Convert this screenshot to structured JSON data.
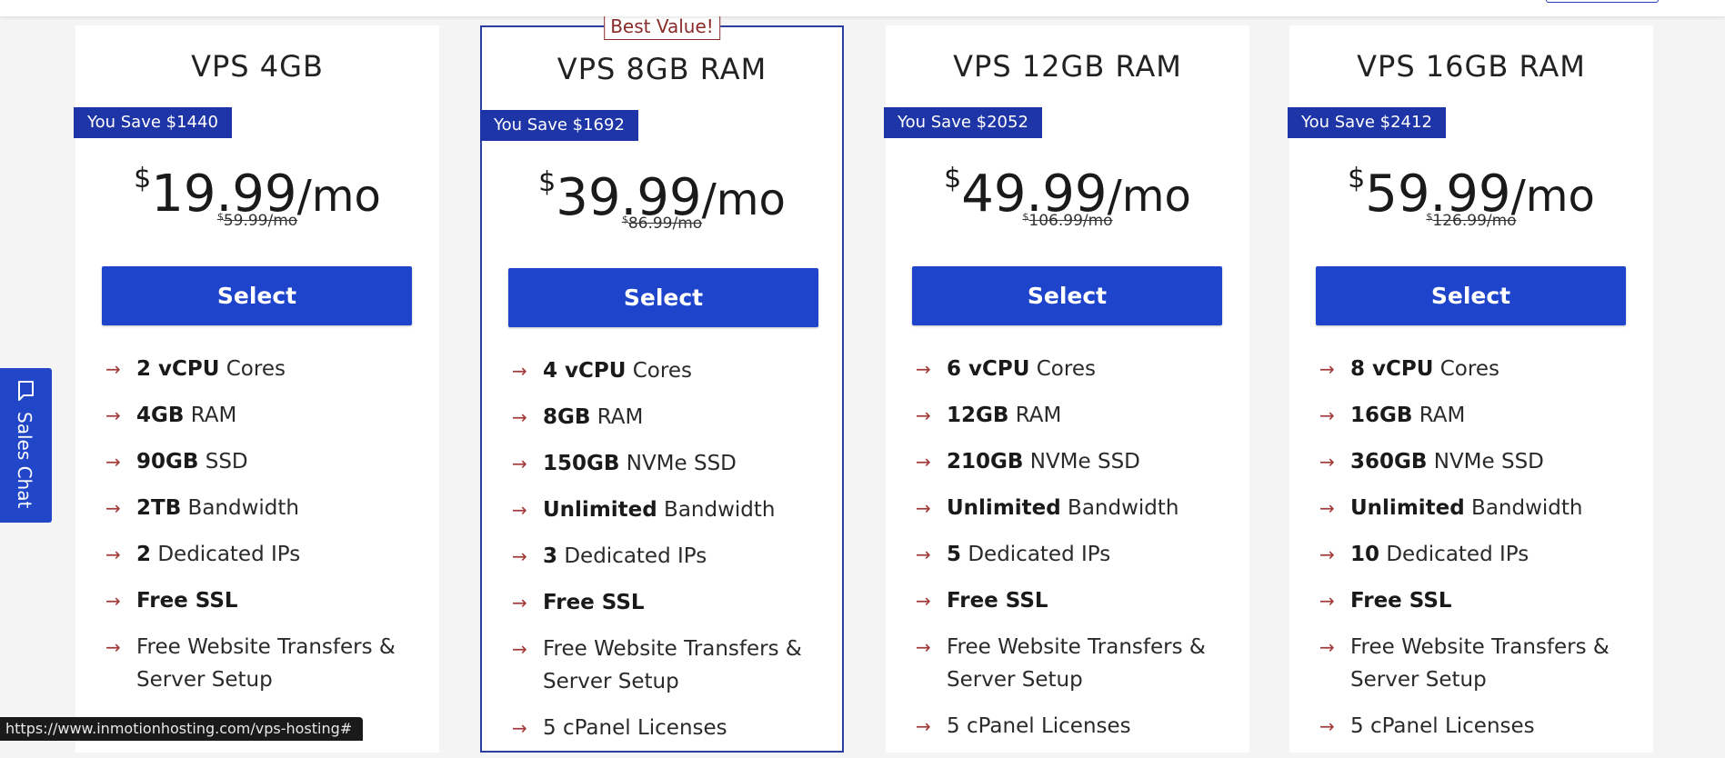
{
  "plans": [
    {
      "title": "VPS 4GB",
      "best_value_label": "",
      "save_label": "You Save $1440",
      "currency": "$",
      "price": "19.99",
      "period": "/mo",
      "old_currency": "$",
      "old_price": "59.99/mo",
      "select_label": "Select",
      "features": [
        {
          "bold": "2 vCPU",
          "text": " Cores",
          "bold_after": ""
        },
        {
          "bold": "4GB",
          "text": " RAM",
          "bold_after": ""
        },
        {
          "bold": "90GB",
          "text": " SSD",
          "bold_after": ""
        },
        {
          "bold": "2TB",
          "text": " Bandwidth",
          "bold_after": ""
        },
        {
          "bold": "2",
          "text": " Dedicated IPs",
          "bold_after": ""
        },
        {
          "bold": "Free SSL",
          "text": "",
          "bold_after": ""
        },
        {
          "bold": "",
          "text": "Free Website Transfers & Server Setup",
          "bold_after": ""
        }
      ]
    },
    {
      "title": "VPS 8GB RAM",
      "best_value_label": "Best Value!",
      "save_label": "You Save $1692",
      "currency": "$",
      "price": "39.99",
      "period": "/mo",
      "old_currency": "$",
      "old_price": "86.99/mo",
      "select_label": "Select",
      "features": [
        {
          "bold": "4 vCPU",
          "text": " Cores",
          "bold_after": ""
        },
        {
          "bold": "8GB",
          "text": " RAM",
          "bold_after": ""
        },
        {
          "bold": "150GB",
          "text": " NVMe SSD",
          "bold_after": ""
        },
        {
          "bold": "Unlimited",
          "text": " Bandwidth",
          "bold_after": ""
        },
        {
          "bold": "3",
          "text": " Dedicated IPs",
          "bold_after": ""
        },
        {
          "bold": "Free SSL",
          "text": "",
          "bold_after": ""
        },
        {
          "bold": "",
          "text": "Free Website Transfers & Server Setup",
          "bold_after": ""
        },
        {
          "bold": "",
          "text": "5 cPanel Licenses",
          "bold_after": ""
        }
      ]
    },
    {
      "title": "VPS 12GB RAM",
      "best_value_label": "",
      "save_label": "You Save $2052",
      "currency": "$",
      "price": "49.99",
      "period": "/mo",
      "old_currency": "$",
      "old_price": "106.99/mo",
      "select_label": "Select",
      "features": [
        {
          "bold": "6 vCPU",
          "text": " Cores",
          "bold_after": ""
        },
        {
          "bold": "12GB",
          "text": " RAM",
          "bold_after": ""
        },
        {
          "bold": "210GB",
          "text": " NVMe SSD",
          "bold_after": ""
        },
        {
          "bold": "Unlimited",
          "text": " Bandwidth",
          "bold_after": ""
        },
        {
          "bold": "5",
          "text": " Dedicated IPs",
          "bold_after": ""
        },
        {
          "bold": "Free SSL",
          "text": "",
          "bold_after": ""
        },
        {
          "bold": "",
          "text": "Free Website Transfers & Server Setup",
          "bold_after": ""
        },
        {
          "bold": "",
          "text": "5 cPanel Licenses",
          "bold_after": ""
        }
      ]
    },
    {
      "title": "VPS 16GB RAM",
      "best_value_label": "",
      "save_label": "You Save $2412",
      "currency": "$",
      "price": "59.99",
      "period": "/mo",
      "old_currency": "$",
      "old_price": "126.99/mo",
      "select_label": "Select",
      "features": [
        {
          "bold": "8 vCPU",
          "text": " Cores",
          "bold_after": ""
        },
        {
          "bold": "16GB",
          "text": " RAM",
          "bold_after": ""
        },
        {
          "bold": "360GB",
          "text": " NVMe SSD",
          "bold_after": ""
        },
        {
          "bold": "Unlimited",
          "text": " Bandwidth",
          "bold_after": ""
        },
        {
          "bold": "10",
          "text": " Dedicated IPs",
          "bold_after": ""
        },
        {
          "bold": "Free SSL",
          "text": "",
          "bold_after": ""
        },
        {
          "bold": "",
          "text": "Free Website Transfers & Server Setup",
          "bold_after": ""
        },
        {
          "bold": "",
          "text": "5 cPanel Licenses",
          "bold_after": ""
        }
      ]
    }
  ],
  "sales_chat": {
    "label": "Sales Chat",
    "icon": "chat-bubble-icon"
  },
  "status_bar": {
    "url": "https://www.inmotionhosting.com/vps-hosting#"
  },
  "colors": {
    "accent_blue": "#1f44cc",
    "badge_blue": "#1e35a8",
    "arrow_red": "#a23a3a",
    "featured_border": "#2b3f9e"
  }
}
